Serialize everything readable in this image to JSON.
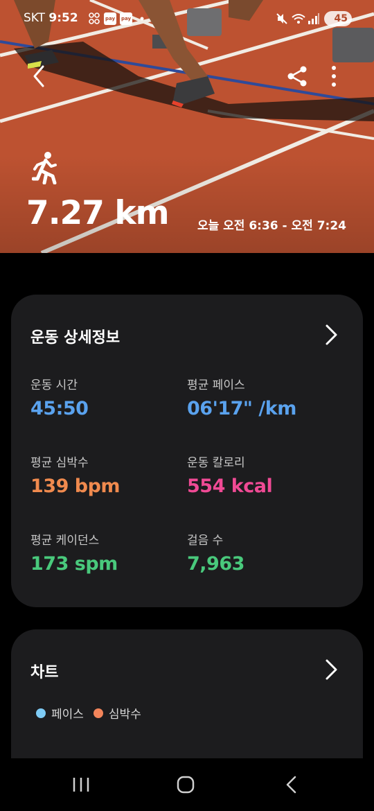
{
  "status_bar": {
    "carrier": "SKT",
    "time": "9:52",
    "battery": "45",
    "pay_badge_1": "pay",
    "pay_badge_2": "pay"
  },
  "hero": {
    "distance": "7.27 km",
    "time_range": "오늘 오전 6:36 - 오전 7:24"
  },
  "details": {
    "title": "운동 상세정보",
    "metrics": [
      {
        "label": "운동 시간",
        "value": "45:50",
        "color": "#5aa2ee"
      },
      {
        "label": "평균 페이스",
        "value": "06'17\" /km",
        "color": "#5aa2ee"
      },
      {
        "label": "평균 심박수",
        "value": "139 bpm",
        "color": "#f08a4e"
      },
      {
        "label": "운동 칼로리",
        "value": "554 kcal",
        "color": "#f04a95"
      },
      {
        "label": "평균 케이던스",
        "value": "173 spm",
        "color": "#49c97c"
      },
      {
        "label": "걸음 수",
        "value": "7,963",
        "color": "#49c97c"
      }
    ]
  },
  "chart": {
    "title": "차트",
    "legend": [
      {
        "label": "페이스",
        "color": "#7ecbf5"
      },
      {
        "label": "심박수",
        "color": "#f2845a"
      }
    ]
  },
  "colors": {
    "card_bg": "#1c1c1e",
    "track": "#b9502e"
  }
}
